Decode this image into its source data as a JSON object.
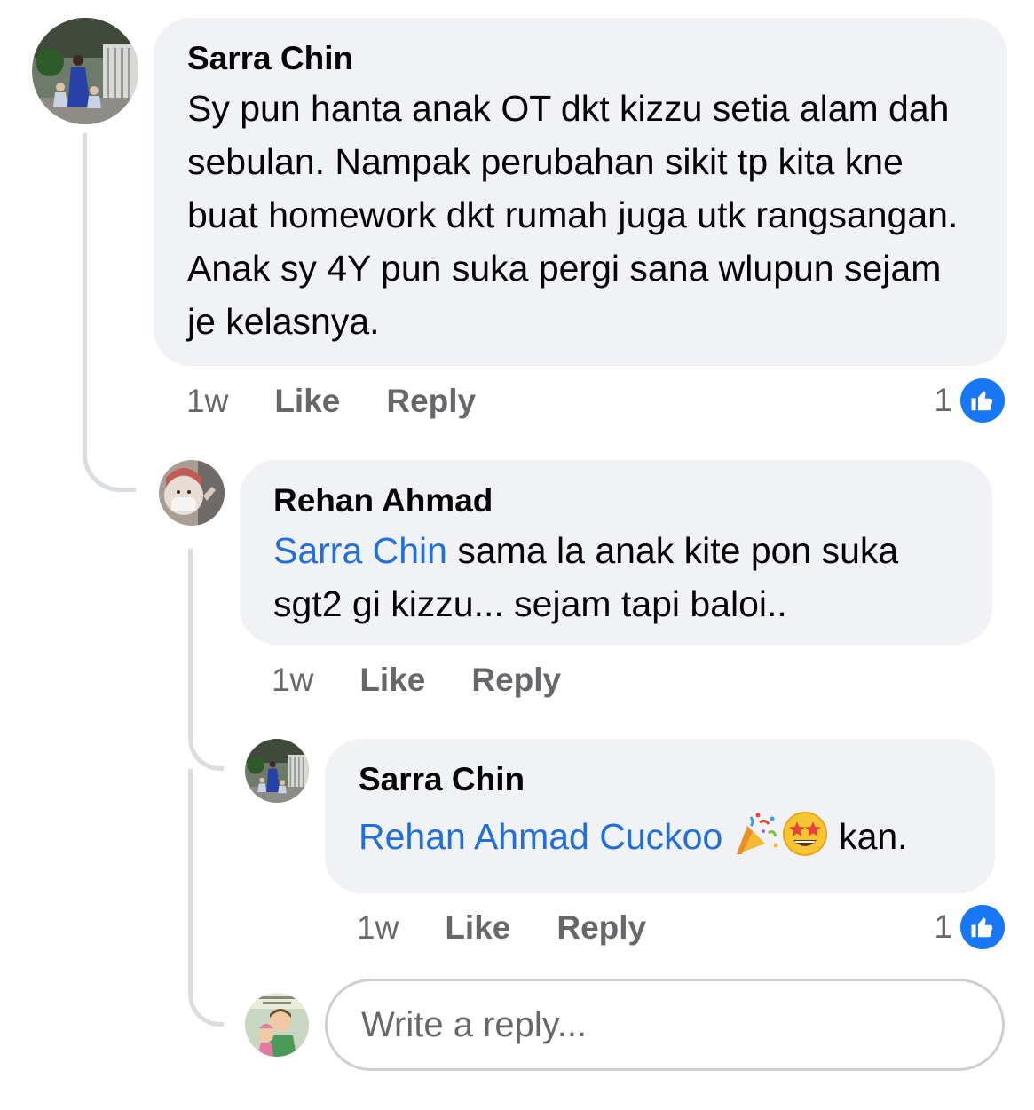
{
  "comments": [
    {
      "author": "Sarra Chin",
      "text": "Sy pun hanta anak OT dkt kizzu setia alam dah sebulan. Nampak perubahan sikit tp kita kne buat homework dkt rumah juga utk rangsangan. Anak sy 4Y pun suka pergi sana wlupun sejam je kelasnya.",
      "time": "1w",
      "like_label": "Like",
      "reply_label": "Reply",
      "reaction_count": "1",
      "reaction_icon": "like-icon"
    },
    {
      "author": "Rehan Ahmad",
      "mention": "Sarra Chin",
      "text": " sama la anak kite pon suka sgt2 gi kizzu... sejam tapi baloi..",
      "time": "1w",
      "like_label": "Like",
      "reply_label": "Reply"
    },
    {
      "author": "Sarra Chin",
      "mention": "Rehan Ahmad Cuckoo",
      "emojis": [
        "party-popper-icon",
        "star-struck-icon"
      ],
      "text": " kan.",
      "time": "1w",
      "like_label": "Like",
      "reply_label": "Reply",
      "reaction_count": "1",
      "reaction_icon": "like-icon"
    }
  ],
  "reply_input": {
    "placeholder": "Write a reply...",
    "value": ""
  },
  "colors": {
    "bubble": "#f0f2f5",
    "mention": "#216fdb",
    "secondary_text": "#65676b",
    "like_blue": "#1877f2",
    "thread_line": "#dadde1"
  }
}
